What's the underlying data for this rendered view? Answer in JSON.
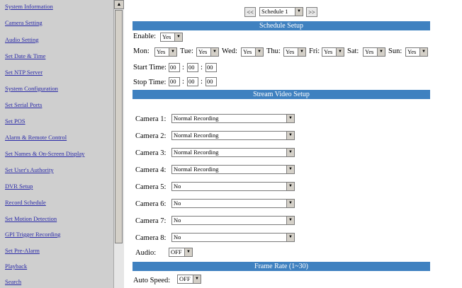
{
  "sidebar": {
    "items": [
      {
        "label": "System Information"
      },
      {
        "label": "Camera Setting"
      },
      {
        "label": "Audio Setting"
      },
      {
        "label": "Set Date & Time"
      },
      {
        "label": "Set NTP Server"
      },
      {
        "label": "System Configuration"
      },
      {
        "label": "Set Serial Ports"
      },
      {
        "label": "Set POS"
      },
      {
        "label": "Alarm & Remote Control"
      },
      {
        "label": "Set Names & On-Screen Display"
      },
      {
        "label": "Set User's Authority"
      },
      {
        "label": "DVR Setup"
      },
      {
        "label": "Record Schedule"
      },
      {
        "label": "Set Motion Detection"
      },
      {
        "label": "GPI Trigger Recording"
      },
      {
        "label": "Set Pre-Alarm"
      },
      {
        "label": "Playback"
      },
      {
        "label": "Search"
      }
    ]
  },
  "nav": {
    "prev_label": "<<",
    "next_label": ">>",
    "schedule_value": "Schedule 1"
  },
  "schedule_setup": {
    "title": "Schedule Setup",
    "enable_label": "Enable:",
    "enable_value": "Yes",
    "days": [
      {
        "label": "Mon:",
        "value": "Yes"
      },
      {
        "label": "Tue:",
        "value": "Yes"
      },
      {
        "label": "Wed:",
        "value": "Yes"
      },
      {
        "label": "Thu:",
        "value": "Yes"
      },
      {
        "label": "Fri:",
        "value": "Yes"
      },
      {
        "label": "Sat:",
        "value": "Yes"
      },
      {
        "label": "Sun:",
        "value": "Yes"
      }
    ],
    "start_time_label": "Start Time:",
    "start_time": [
      "00",
      "00",
      "00"
    ],
    "stop_time_label": "Stop Time:",
    "stop_time": [
      "00",
      "00",
      "00"
    ],
    "time_sep": ":"
  },
  "stream_video_setup": {
    "title": "Stream Video Setup",
    "cameras": [
      {
        "label": "Camera 1:",
        "value": "Normal Recording"
      },
      {
        "label": "Camera 2:",
        "value": "Normal Recording"
      },
      {
        "label": "Camera 3:",
        "value": "Normal Recording"
      },
      {
        "label": "Camera 4:",
        "value": "Normal Recording"
      },
      {
        "label": "Camera 5:",
        "value": "No"
      },
      {
        "label": "Camera 6:",
        "value": "No"
      },
      {
        "label": "Camera 7:",
        "value": "No"
      },
      {
        "label": "Camera 8:",
        "value": "No"
      }
    ],
    "audio_label": "Audio:",
    "audio_value": "OFF"
  },
  "frame_rate": {
    "title": "Frame Rate (1~30)",
    "auto_speed_label": "Auto Speed:",
    "auto_speed_value": "OFF"
  },
  "icons": {
    "dropdown": "chevron-down-icon",
    "scroll_up": "arrow-up-icon"
  },
  "colors": {
    "section_bar": "#3f81c0",
    "link": "#2a2aa8",
    "sidebar_bg": "#cfcfcf"
  }
}
